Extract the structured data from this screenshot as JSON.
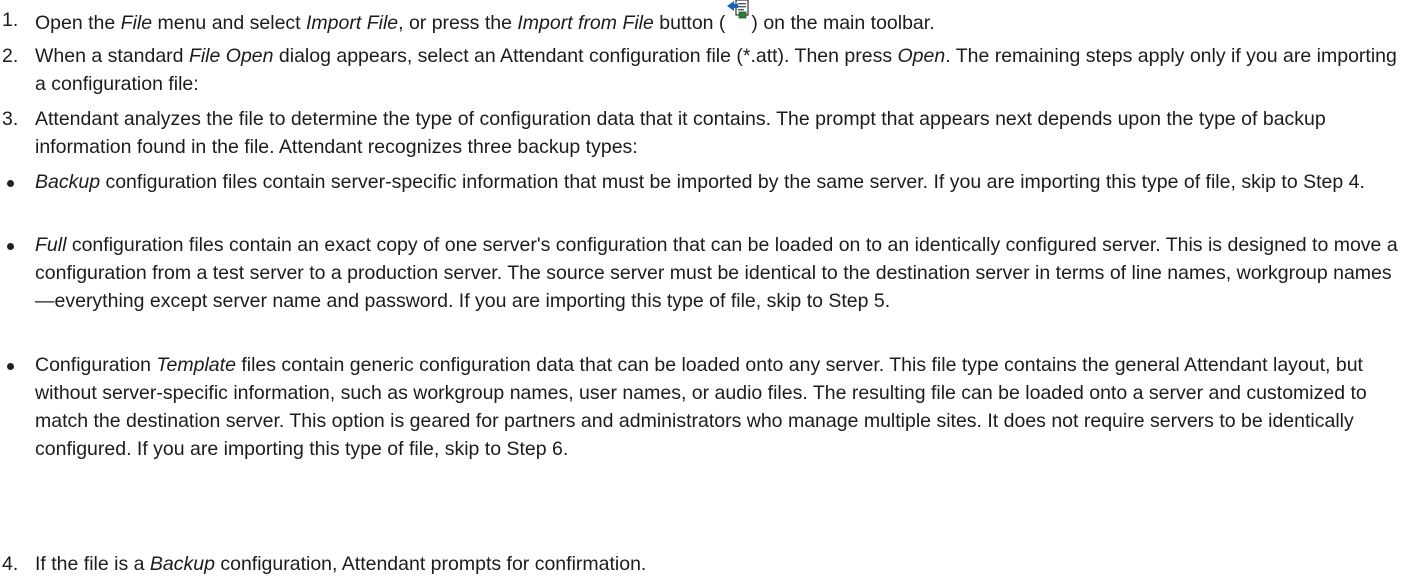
{
  "steps": [
    {
      "number": "1.",
      "parts": [
        {
          "t": "Open the "
        },
        {
          "t": "File",
          "i": true
        },
        {
          "t": " menu and select "
        },
        {
          "t": "Import File",
          "i": true
        },
        {
          "t": ", or press the "
        },
        {
          "t": "Import from File",
          "i": true
        },
        {
          "t": " button ("
        },
        {
          "icon": "import-from-file-icon"
        },
        {
          "t": ") on the main toolbar."
        }
      ]
    },
    {
      "number": "2.",
      "parts": [
        {
          "t": "When a standard "
        },
        {
          "t": "File Open",
          "i": true
        },
        {
          "t": " dialog appears, select an Attendant configuration file (*.att).  Then press "
        },
        {
          "t": "Open",
          "i": true
        },
        {
          "t": ". The remaining steps apply only if you are importing a configuration file:"
        }
      ]
    },
    {
      "number": "3.",
      "parts": [
        {
          "t": "Attendant analyzes the file to determine the type of configuration data that it contains.  The prompt that appears next depends upon the type of backup information found in the file.  Attendant recognizes three backup types:"
        }
      ]
    }
  ],
  "bullets": [
    {
      "parts": [
        {
          "t": "Backup",
          "i": true
        },
        {
          "t": " configuration files contain server-specific information that must be imported by the same server.  If you are importing this type of file, skip to Step 4."
        }
      ]
    },
    {
      "parts": [
        {
          "t": "Full",
          "i": true
        },
        {
          "t": " configuration files contain an exact copy of one server's configuration that can be loaded on to an identically configured server.  This is designed to move a configuration from a test server to a production server.  The source server must be identical to the destination server in terms of line names, workgroup names—everything except server name and password. If you are importing this type of file, skip to Step 5."
        }
      ]
    },
    {
      "parts": [
        {
          "t": "Configuration "
        },
        {
          "t": "Template",
          "i": true
        },
        {
          "t": " files contain generic configuration data that can be loaded onto any server.  This file type contains the general Attendant layout, but without server-specific information, such as workgroup names, user names, or audio files.  The resulting file can be loaded onto a server and customized to match the destination server.   This option is geared for partners and administrators who manage multiple sites.  It does not require servers to be identically configured.  If you are importing this type of file, skip to Step 6."
        }
      ]
    }
  ],
  "final_step": {
    "number": "4.",
    "parts": [
      {
        "t": "If the file is a "
      },
      {
        "t": "Backup",
        "i": true
      },
      {
        "t": " configuration, Attendant prompts for confirmation."
      }
    ]
  }
}
